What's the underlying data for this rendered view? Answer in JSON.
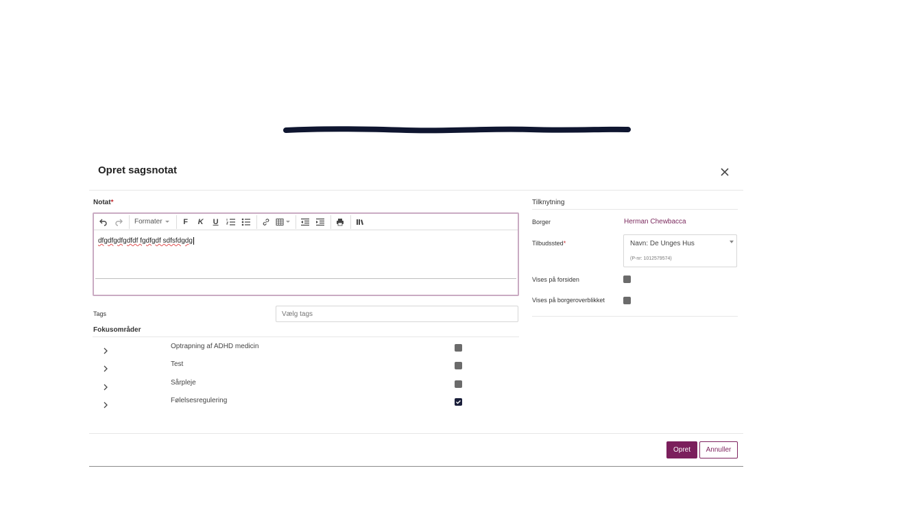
{
  "modal": {
    "title": "Opret sagsnotat"
  },
  "note": {
    "label": "Notat",
    "required_mark": "*",
    "toolbar": {
      "format_label": "Formater",
      "bold_label": "F",
      "italic_label": "K",
      "underline_label": "U"
    },
    "content": "dfgdfgdfgdfdf fgdfgdf sdfsfdgdg"
  },
  "tags": {
    "label": "Tags",
    "placeholder": "Vælg tags"
  },
  "focus_areas": {
    "label": "Fokusområder",
    "items": [
      {
        "label": "Optrapning af ADHD medicin",
        "checked": false
      },
      {
        "label": "Test",
        "checked": false
      },
      {
        "label": "Sårpleje",
        "checked": false
      },
      {
        "label": "Følelsesregulering",
        "checked": true
      }
    ]
  },
  "association": {
    "heading": "Tilknytning",
    "borger_label": "Borger",
    "borger_value": "Herman Chewbacca",
    "offer_label": "Tilbudssted",
    "offer_required_mark": "*",
    "offer_name": "Navn: De Unges Hus",
    "offer_pnr": "(P-nr: 1012579574)",
    "show_frontpage_label": "Vises på forsiden",
    "show_overview_label": "Vises på borgeroverblikket"
  },
  "footer": {
    "create_label": "Opret",
    "cancel_label": "Annuller"
  },
  "colors": {
    "accent": "#7b1f5c",
    "link": "#7b2a5e",
    "editor_border": "#c9aac2",
    "redaction": "#0f1630"
  }
}
